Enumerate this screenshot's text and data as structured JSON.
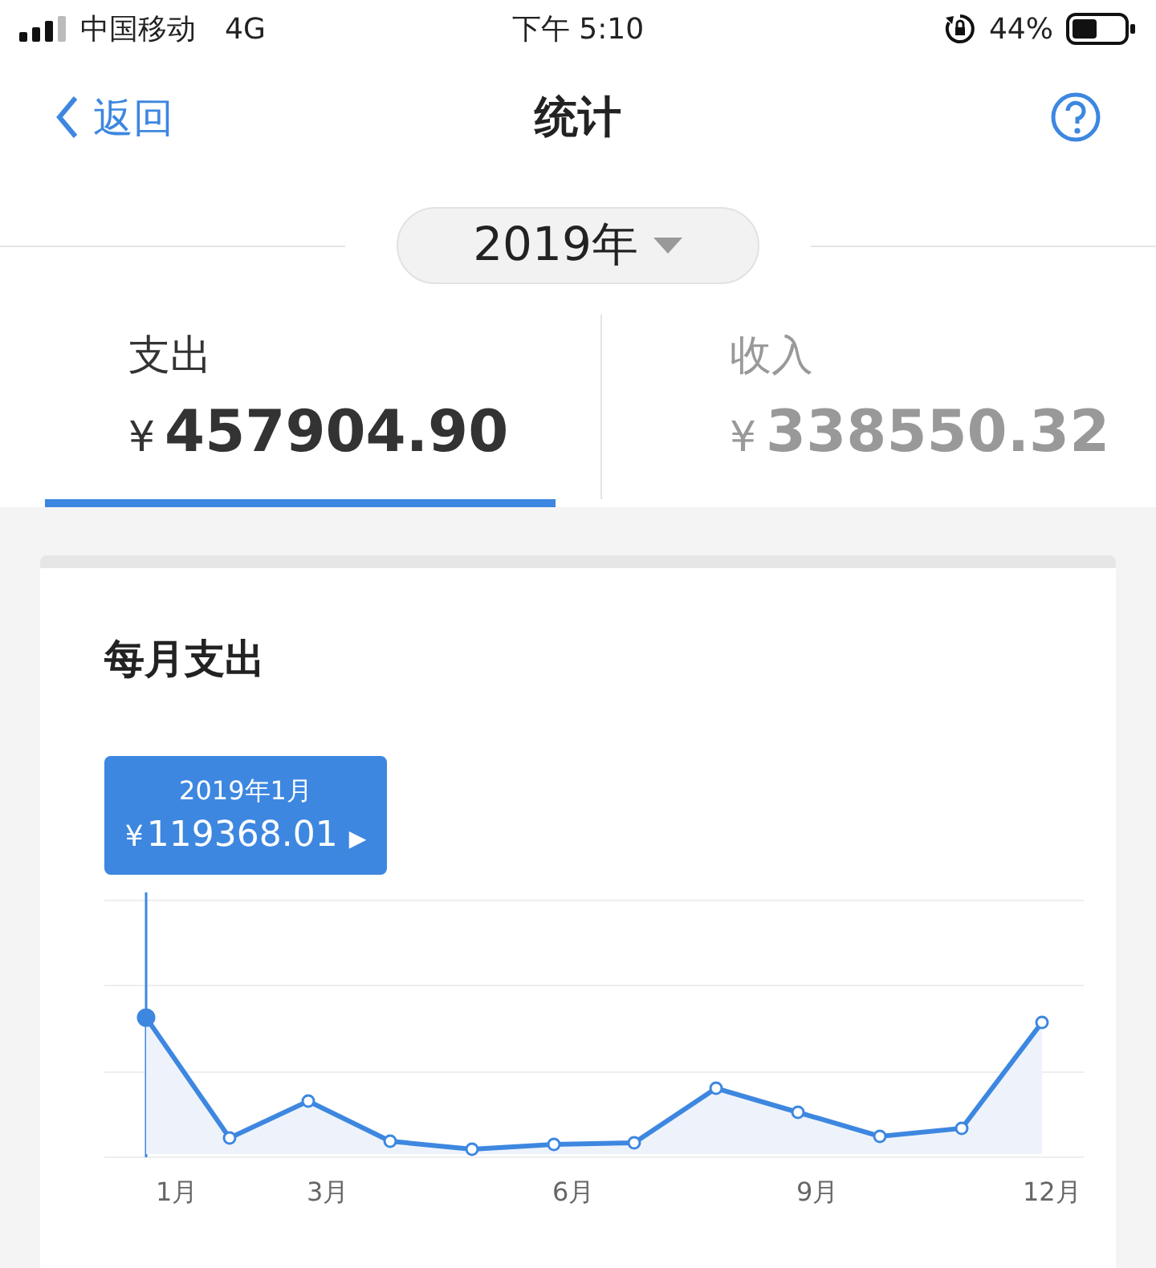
{
  "status_bar": {
    "carrier": "中国移动",
    "network": "4G",
    "time": "下午 5:10",
    "battery": "44%"
  },
  "nav": {
    "back": "返回",
    "title": "统计"
  },
  "year_picker": {
    "label": "2019年"
  },
  "tabs": [
    {
      "label": "支出",
      "currency": "¥",
      "amount": "457904.90",
      "selected": true
    },
    {
      "label": "收入",
      "currency": "¥",
      "amount": "338550.32",
      "selected": false
    }
  ],
  "card": {
    "title": "每月支出",
    "tooltip": {
      "date": "2019年1月",
      "currency": "¥",
      "amount": "119368.01",
      "arrow": "▶"
    },
    "x_labels": [
      "1月",
      "3月",
      "6月",
      "9月",
      "12月"
    ]
  }
}
